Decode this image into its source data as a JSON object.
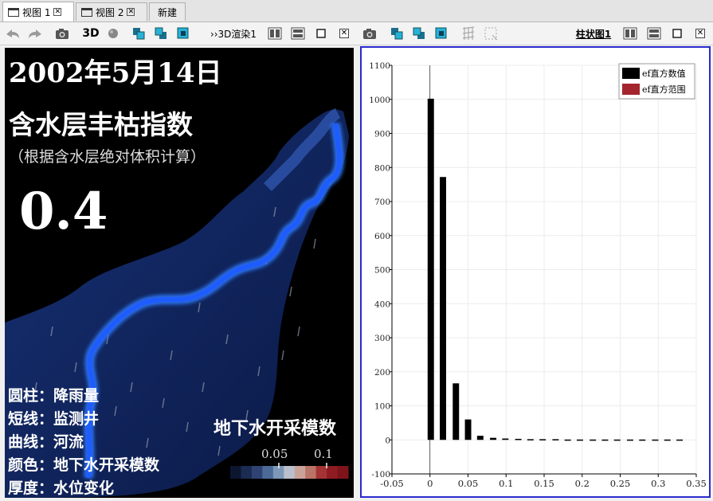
{
  "tabs": [
    {
      "label": "视图 1",
      "active": true
    },
    {
      "label": "视图 2",
      "active": false
    },
    {
      "label": "新建",
      "active": false
    }
  ],
  "toolbar": {
    "label_3d": "3D",
    "render_label": "››3D渲染1",
    "chart_label": "柱状图1",
    "close_glyph": "✕"
  },
  "view3d": {
    "date": "2002年5月14日",
    "index_title": "含水层丰枯指数",
    "index_note": "（根据含水层绝对体积计算）",
    "index_value": "0.4",
    "legend": [
      {
        "label": "圆柱：",
        "value": "降雨量"
      },
      {
        "label": "短线：",
        "value": "监测井"
      },
      {
        "label": "曲线：",
        "value": "河流"
      },
      {
        "label": "颜色：",
        "value": "地下水开采模数"
      },
      {
        "label": "厚度：",
        "value": "水位变化"
      }
    ],
    "colorbar": {
      "title": "地下水开采模数",
      "tick1": "0.05",
      "tick2": "0.1",
      "colors": [
        "#0d1630",
        "#1c2b52",
        "#2e4373",
        "#4c6a98",
        "#7d97b8",
        "#b9bfcc",
        "#c9a39a",
        "#b97467",
        "#a43335",
        "#8e1c22",
        "#7e141a"
      ]
    }
  },
  "chart_data": {
    "type": "bar",
    "series": [
      {
        "name": "ef直方数值",
        "color": "#000000",
        "x": [
          0,
          0.016,
          0.033,
          0.049,
          0.065,
          0.082,
          0.098,
          0.115,
          0.131,
          0.147,
          0.164,
          0.18,
          0.196,
          0.213,
          0.229,
          0.245,
          0.262,
          0.278,
          0.295,
          0.311,
          0.327
        ],
        "values": [
          1002,
          772,
          166,
          60,
          12,
          6,
          4,
          3,
          2,
          2,
          2,
          1,
          1,
          1,
          1,
          1,
          1,
          1,
          1,
          1,
          1
        ]
      },
      {
        "name": "ef直方范围",
        "color": "#a4252d"
      }
    ],
    "xlim": [
      -0.05,
      0.35
    ],
    "ylim": [
      -100,
      1100
    ],
    "xticks": [
      "-0.05",
      "0",
      "0.05",
      "0.1",
      "0.15",
      "0.2",
      "0.25",
      "0.3",
      "0.35"
    ],
    "yticks": [
      "-100",
      "0",
      "100",
      "200",
      "300",
      "400",
      "500",
      "600",
      "700",
      "800",
      "900",
      "1000",
      "1100"
    ],
    "grid": true,
    "legend_position": "top-right"
  }
}
